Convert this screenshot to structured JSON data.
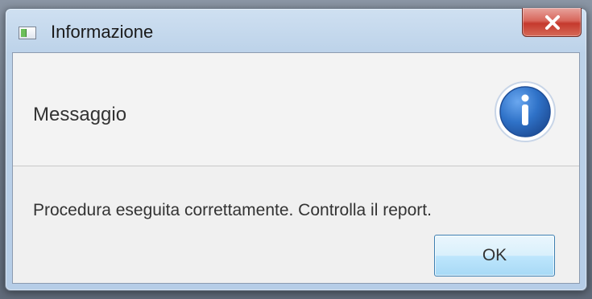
{
  "window": {
    "title": "Informazione",
    "icon": "app-window-icon"
  },
  "titlebar": {
    "close_icon": "close-icon"
  },
  "dialog": {
    "header": "Messaggio",
    "message": "Procedura eseguita correttamente. Controlla il report.",
    "ok_label": "OK",
    "icon": "info-icon"
  },
  "colors": {
    "info_blue": "#2f72c8",
    "close_red": "#c5392d",
    "ok_border": "#3c7fb1"
  }
}
